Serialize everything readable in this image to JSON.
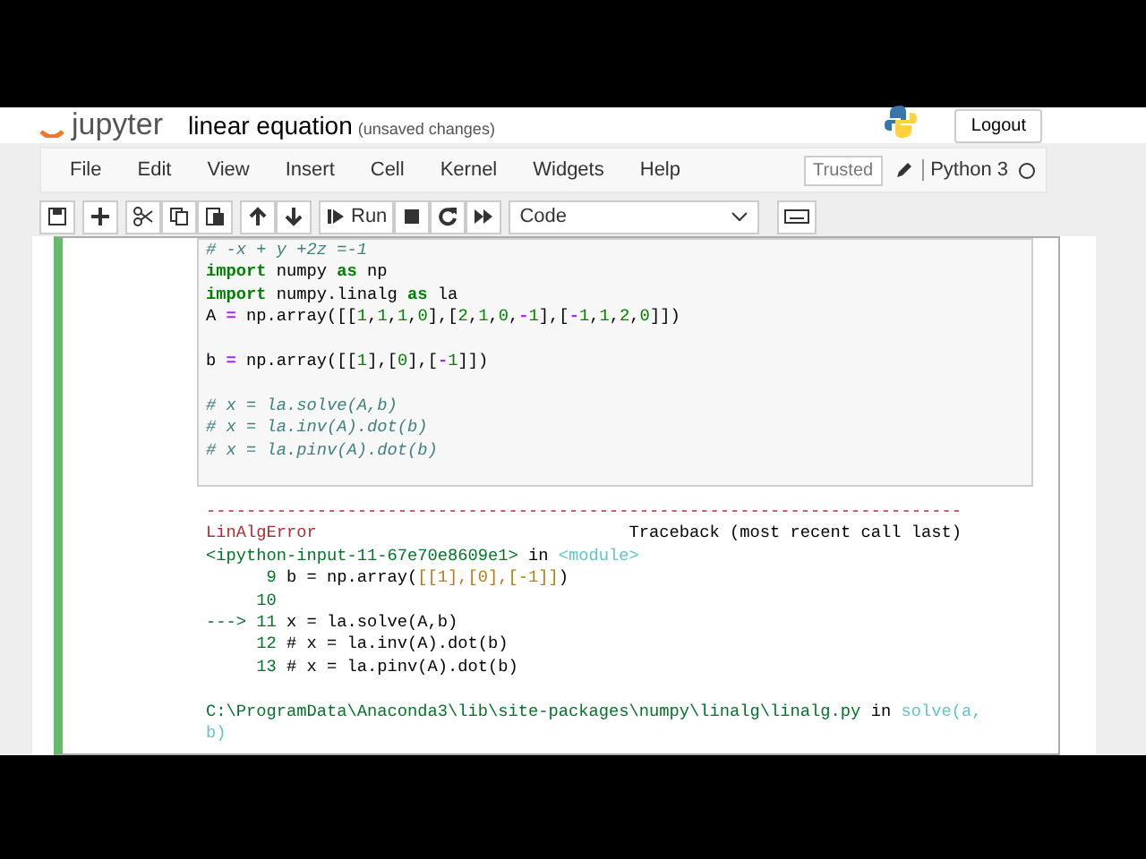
{
  "header": {
    "logo": "jupyter",
    "notebook_name": "linear equation",
    "save_status": "(unsaved changes)",
    "logout": "Logout"
  },
  "menu": [
    "File",
    "Edit",
    "View",
    "Insert",
    "Cell",
    "Kernel",
    "Widgets",
    "Help"
  ],
  "kernel": {
    "trusted": "Trusted",
    "name": "Python 3",
    "busy": false
  },
  "toolbar": {
    "run": "Run",
    "cell_type": "Code"
  },
  "cell": {
    "selected": true,
    "code_blocks": [
      {
        "lines": [
          [
            {
              "kind": "comment",
              "text": "# -x + y +2z =-1"
            }
          ],
          [
            {
              "kind": "keyword",
              "text": "import"
            },
            {
              "kind": "plain",
              "text": " numpy "
            },
            {
              "kind": "keyword",
              "text": "as"
            },
            {
              "kind": "plain",
              "text": " np"
            }
          ],
          [
            {
              "kind": "keyword",
              "text": "import"
            },
            {
              "kind": "plain",
              "text": " numpy.linalg "
            },
            {
              "kind": "keyword",
              "text": "as"
            },
            {
              "kind": "plain",
              "text": " la"
            }
          ],
          [
            {
              "kind": "plain",
              "text": "A "
            },
            {
              "kind": "operator",
              "text": "="
            },
            {
              "kind": "plain",
              "text": " np.array([["
            },
            {
              "kind": "number",
              "text": "1"
            },
            {
              "kind": "plain",
              "text": ","
            },
            {
              "kind": "number",
              "text": "1"
            },
            {
              "kind": "plain",
              "text": ","
            },
            {
              "kind": "number",
              "text": "1"
            },
            {
              "kind": "plain",
              "text": ","
            },
            {
              "kind": "number",
              "text": "0"
            },
            {
              "kind": "plain",
              "text": "],["
            },
            {
              "kind": "number",
              "text": "2"
            },
            {
              "kind": "plain",
              "text": ","
            },
            {
              "kind": "number",
              "text": "1"
            },
            {
              "kind": "plain",
              "text": ","
            },
            {
              "kind": "number",
              "text": "0"
            },
            {
              "kind": "plain",
              "text": ","
            },
            {
              "kind": "operator",
              "text": "-"
            },
            {
              "kind": "number",
              "text": "1"
            },
            {
              "kind": "plain",
              "text": "],["
            },
            {
              "kind": "operator",
              "text": "-"
            },
            {
              "kind": "number",
              "text": "1"
            },
            {
              "kind": "plain",
              "text": ","
            },
            {
              "kind": "number",
              "text": "1"
            },
            {
              "kind": "plain",
              "text": ","
            },
            {
              "kind": "number",
              "text": "2"
            },
            {
              "kind": "plain",
              "text": ","
            },
            {
              "kind": "number",
              "text": "0"
            },
            {
              "kind": "plain",
              "text": "]])"
            }
          ]
        ]
      },
      {
        "lines": [
          [
            {
              "kind": "plain",
              "text": "b "
            },
            {
              "kind": "operator",
              "text": "="
            },
            {
              "kind": "plain",
              "text": " np.array([["
            },
            {
              "kind": "number",
              "text": "1"
            },
            {
              "kind": "plain",
              "text": "],["
            },
            {
              "kind": "number",
              "text": "0"
            },
            {
              "kind": "plain",
              "text": "],["
            },
            {
              "kind": "operator",
              "text": "-"
            },
            {
              "kind": "number",
              "text": "1"
            },
            {
              "kind": "plain",
              "text": "]])"
            }
          ]
        ]
      },
      {
        "lines": [
          [
            {
              "kind": "comment",
              "text": "# x = la.solve(A,b)"
            }
          ],
          [
            {
              "kind": "comment",
              "text": "# x = la.inv(A).dot(b)"
            }
          ],
          [
            {
              "kind": "comment",
              "text": "# x = la.pinv(A).dot(b)"
            }
          ]
        ]
      }
    ],
    "output_blocks": [
      {
        "lines": [
          [
            {
              "kind": "error",
              "text": "---------------------------------------------------------------------------"
            }
          ],
          [
            {
              "kind": "error",
              "text": "LinAlgError"
            },
            {
              "kind": "plain",
              "text": "                               Traceback (most recent call last)"
            }
          ],
          [
            {
              "kind": "green",
              "text": "<ipython-input-11-67e70e8609e1>"
            },
            {
              "kind": "plain",
              "text": " in "
            },
            {
              "kind": "cyan",
              "text": "<module>"
            }
          ],
          [
            {
              "kind": "green",
              "text": "      9"
            },
            {
              "kind": "plain",
              "text": " b = np.array("
            },
            {
              "kind": "bracket",
              "text": "[[1],[0],[-1]]"
            },
            {
              "kind": "plain",
              "text": ")"
            }
          ],
          [
            {
              "kind": "green",
              "text": "     10"
            }
          ],
          [
            {
              "kind": "green",
              "text": "---> 11"
            },
            {
              "kind": "plain",
              "text": " x = la.solve(A,b)"
            }
          ],
          [
            {
              "kind": "green",
              "text": "     12"
            },
            {
              "kind": "plain",
              "text": " # x = la.inv(A).dot(b)"
            }
          ],
          [
            {
              "kind": "green",
              "text": "     13"
            },
            {
              "kind": "plain",
              "text": " # x = la.pinv(A).dot(b)"
            }
          ]
        ]
      },
      {
        "lines": [
          [
            {
              "kind": "green",
              "text": "C:\\ProgramData\\Anaconda3\\lib\\site-packages\\numpy\\linalg\\linalg.py"
            },
            {
              "kind": "plain",
              "text": " in "
            },
            {
              "kind": "cyan",
              "text": "solve(a,"
            }
          ],
          [
            {
              "kind": "cyan",
              "text": "b)"
            }
          ]
        ]
      }
    ]
  }
}
